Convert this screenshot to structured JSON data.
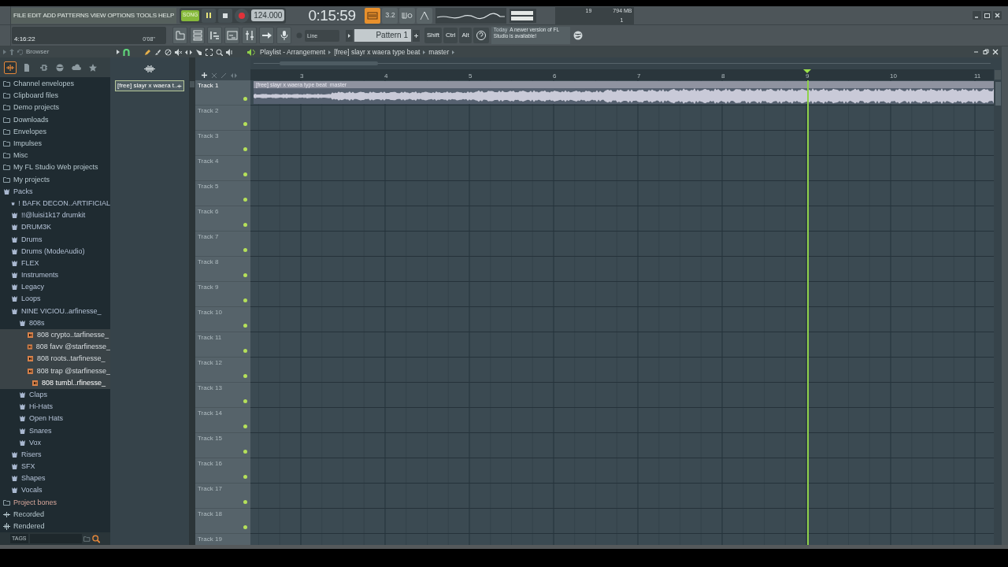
{
  "menu": [
    "FILE",
    "EDIT",
    "ADD",
    "PATTERNS",
    "VIEW",
    "OPTIONS",
    "TOOLS",
    "HELP"
  ],
  "transport": {
    "mode": "SONG",
    "playing": true,
    "tempo": "124.000",
    "time": "0:15:59"
  },
  "toolbar": [
    {
      "kind": "keyboard",
      "on": true
    },
    {
      "kind": "step",
      "label": "3.2",
      "on": false
    },
    {
      "kind": "blend",
      "on": false
    },
    {
      "kind": "metronome",
      "on": false
    }
  ],
  "monitor": {
    "cpu": "19",
    "memory": "794 MB",
    "polyphony": "1"
  },
  "hint": {
    "duration": "4:16:22",
    "length": "0'08''"
  },
  "snap": "Line",
  "pattern": "Pattern 1",
  "modifier_keys": [
    "Shift",
    "Ctrl",
    "Alt"
  ],
  "news": {
    "when": "Today",
    "message": "A newer version of FL Studio is available!"
  },
  "browser": {
    "title": "Browser",
    "tabs": [
      {
        "selected": true
      },
      {
        "selected": false
      },
      {
        "selected": false
      },
      {
        "selected": false
      },
      {
        "selected": false
      },
      {
        "selected": false
      }
    ],
    "items": [
      {
        "name": "Channel envelopes",
        "kind": "folder",
        "selected": false
      },
      {
        "name": "Clipboard files",
        "kind": "folder",
        "selected": false
      },
      {
        "name": "Demo projects",
        "kind": "folder",
        "selected": false
      },
      {
        "name": "Downloads",
        "kind": "folder",
        "selected": false
      },
      {
        "name": "Envelopes",
        "kind": "folder",
        "selected": false
      },
      {
        "name": "Impulses",
        "kind": "folder",
        "selected": false
      },
      {
        "name": "Misc",
        "kind": "folder",
        "selected": false
      },
      {
        "name": "My FL Studio Web projects",
        "kind": "folder",
        "selected": false
      },
      {
        "name": "My projects",
        "kind": "folder",
        "selected": false
      },
      {
        "name": "Packs",
        "kind": "pack",
        "selected": false,
        "children": [
          {
            "name": "!  BAFK DECON..ARTIFICIAL",
            "kind": "pack",
            "selected": false
          },
          {
            "name": "!!@luisi1k17 drumkit",
            "kind": "pack",
            "selected": false
          },
          {
            "name": "DRUM3K",
            "kind": "pack",
            "selected": false
          },
          {
            "name": "Drums",
            "kind": "pack",
            "selected": false
          },
          {
            "name": "Drums (ModeAudio)",
            "kind": "pack",
            "selected": false
          },
          {
            "name": "FLEX",
            "kind": "pack",
            "selected": false
          },
          {
            "name": "Instruments",
            "kind": "pack",
            "selected": false
          },
          {
            "name": "Legacy",
            "kind": "pack",
            "selected": false
          },
          {
            "name": "Loops",
            "kind": "pack",
            "selected": false
          },
          {
            "name": "NINE VICIOU..arfinesse_",
            "kind": "pack",
            "selected": false,
            "children": [
              {
                "name": "808s",
                "kind": "pack",
                "selected": false,
                "children": [
                  {
                    "name": "808 crypto..tarfinesse_",
                    "kind": "sample",
                    "selected": false
                  },
                  {
                    "name": "808 favv @starfinesse_",
                    "kind": "sample",
                    "selected": false
                  },
                  {
                    "name": "808 roots..tarfinesse_",
                    "kind": "sample",
                    "selected": false
                  },
                  {
                    "name": "808 trap @starfinesse_",
                    "kind": "sample",
                    "selected": false
                  },
                  {
                    "name": "808 tumbl..rfinesse_",
                    "kind": "sample",
                    "selected": true
                  }
                ]
              },
              {
                "name": "Claps",
                "kind": "pack",
                "selected": false
              },
              {
                "name": "Hi-Hats",
                "kind": "pack",
                "selected": false
              },
              {
                "name": "Open Hats",
                "kind": "pack",
                "selected": false
              },
              {
                "name": "Snares",
                "kind": "pack",
                "selected": false
              },
              {
                "name": "Vox",
                "kind": "pack",
                "selected": false
              }
            ]
          },
          {
            "name": "Risers",
            "kind": "pack",
            "selected": false
          },
          {
            "name": "SFX",
            "kind": "pack",
            "selected": false
          },
          {
            "name": "Shapes",
            "kind": "pack",
            "selected": false
          },
          {
            "name": "Vocals",
            "kind": "pack",
            "selected": false
          }
        ]
      },
      {
        "name": "Project bones",
        "kind": "project",
        "selected": false
      },
      {
        "name": "Recorded",
        "kind": "recorded",
        "selected": false
      },
      {
        "name": "Rendered",
        "kind": "rendered",
        "selected": false
      }
    ],
    "tags": "TAGS"
  },
  "playlist": {
    "title": "Playlist - Arrangement",
    "path": [
      "[free] slayr x waera type beat",
      "master"
    ],
    "patterns": [
      {
        "name": "[free] slayr x waera t..",
        "selected": true
      }
    ],
    "ruler": [
      "3",
      "4",
      "5",
      "6",
      "7",
      "8",
      "9",
      "10",
      "11"
    ],
    "tracks": [
      {
        "name": "Track 1",
        "enabled": true,
        "clip": "[free] slayr x waera type beat  master"
      },
      {
        "name": "Track 2",
        "enabled": true
      },
      {
        "name": "Track 3",
        "enabled": true
      },
      {
        "name": "Track 4",
        "enabled": true
      },
      {
        "name": "Track 5",
        "enabled": true
      },
      {
        "name": "Track 6",
        "enabled": true
      },
      {
        "name": "Track 7",
        "enabled": true
      },
      {
        "name": "Track 8",
        "enabled": true
      },
      {
        "name": "Track 9",
        "enabled": true
      },
      {
        "name": "Track 10",
        "enabled": true
      },
      {
        "name": "Track 11",
        "enabled": true
      },
      {
        "name": "Track 12",
        "enabled": true
      },
      {
        "name": "Track 13",
        "enabled": true
      },
      {
        "name": "Track 14",
        "enabled": true
      },
      {
        "name": "Track 15",
        "enabled": true
      },
      {
        "name": "Track 16",
        "enabled": true
      },
      {
        "name": "Track 17",
        "enabled": true
      },
      {
        "name": "Track 18",
        "enabled": true
      },
      {
        "name": "Track 19"
      }
    ]
  }
}
